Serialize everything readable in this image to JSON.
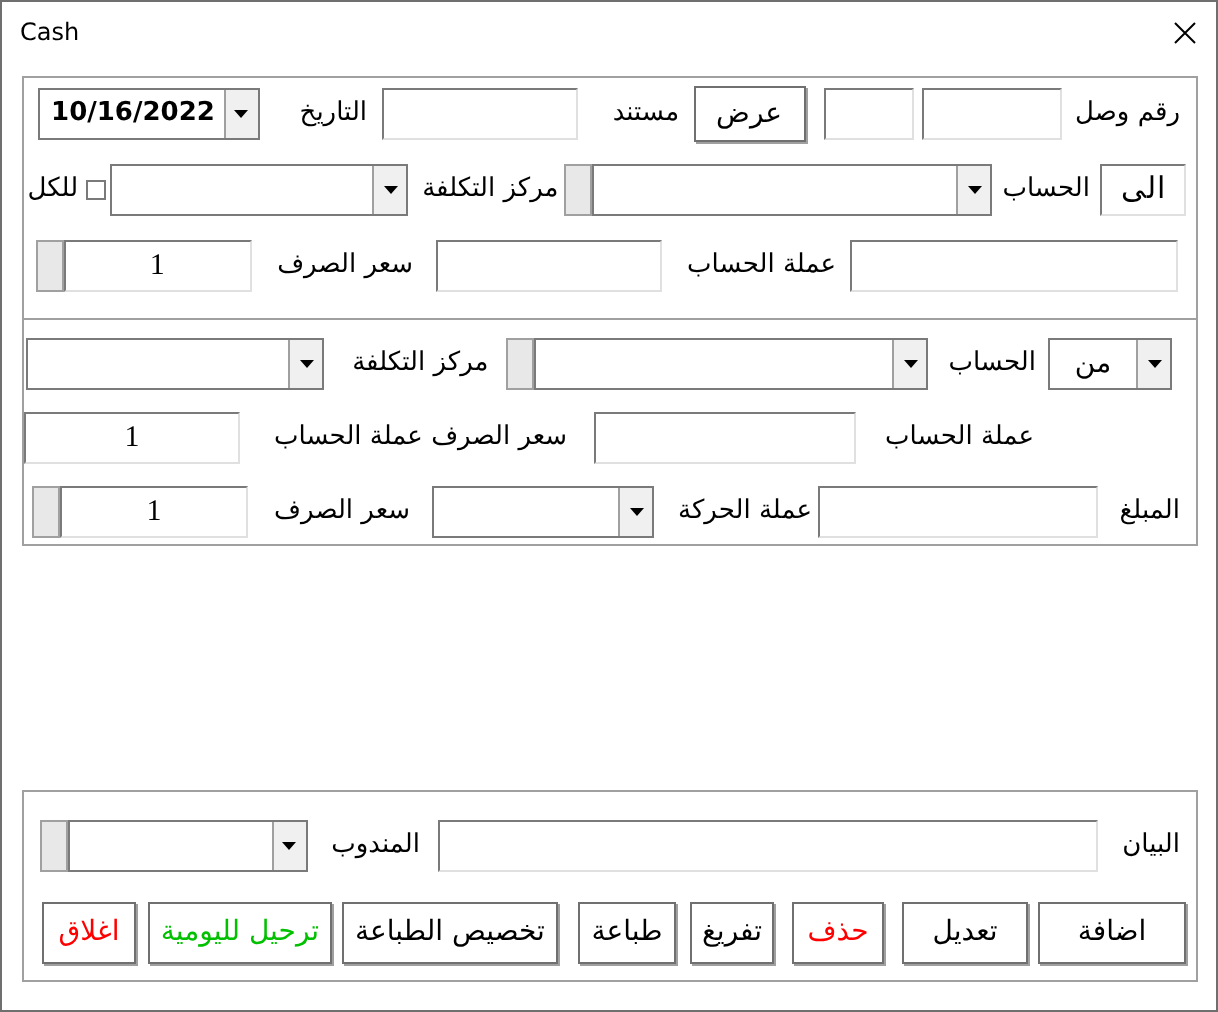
{
  "window": {
    "title": "Cash"
  },
  "receipt_panel": {
    "rows": [
      {
        "items": [
          {
            "kind": "label",
            "text": "رقم وصل"
          },
          {
            "kind": "field"
          },
          {
            "kind": "field"
          },
          {
            "kind": "button",
            "label": "عرض"
          },
          {
            "kind": "label",
            "text": "مستند"
          },
          {
            "kind": "field"
          },
          {
            "kind": "label",
            "text": "التاريخ"
          },
          {
            "kind": "date",
            "value": "10/16/2022"
          }
        ]
      },
      {
        "items": [
          {
            "kind": "field",
            "value": "الى"
          },
          {
            "kind": "label",
            "text": "الحساب"
          },
          {
            "kind": "combo",
            "spinner": true
          },
          {
            "kind": "label",
            "text": "مركز التكلفة"
          },
          {
            "kind": "combo"
          },
          {
            "kind": "checkbox",
            "label": "للكل",
            "checked": false
          }
        ]
      },
      {
        "items": [
          {
            "kind": "field"
          },
          {
            "kind": "label",
            "text": "عملة الحساب"
          },
          {
            "kind": "field"
          },
          {
            "kind": "label",
            "text": "سعر الصرف"
          },
          {
            "kind": "field",
            "value": "1",
            "spinner": true
          }
        ]
      }
    ]
  },
  "from_panel": {
    "rows": [
      {
        "items": [
          {
            "kind": "combo",
            "value": "من"
          },
          {
            "kind": "label",
            "text": "الحساب"
          },
          {
            "kind": "combo",
            "spinner": true
          },
          {
            "kind": "label",
            "text": "مركز التكلفة"
          },
          {
            "kind": "combo"
          }
        ]
      },
      {
        "items": [
          {
            "kind": "label",
            "text": "عملة الحساب"
          },
          {
            "kind": "field"
          },
          {
            "kind": "label",
            "text": "سعر الصرف عملة الحساب"
          },
          {
            "kind": "field",
            "value": "1"
          }
        ]
      },
      {
        "items": [
          {
            "kind": "label",
            "text": "المبلغ"
          },
          {
            "kind": "field"
          },
          {
            "kind": "label",
            "text": "عملة الحركة"
          },
          {
            "kind": "combo"
          },
          {
            "kind": "label",
            "text": "سعر الصرف"
          },
          {
            "kind": "field",
            "value": "1",
            "spinner": true
          }
        ]
      }
    ]
  },
  "notes_panel": {
    "rows": [
      {
        "items": [
          {
            "kind": "label",
            "text": "البيان"
          },
          {
            "kind": "field"
          },
          {
            "kind": "label",
            "text": "المندوب"
          },
          {
            "kind": "combo",
            "spinner": true
          }
        ]
      }
    ]
  },
  "buttons": [
    {
      "label": "اضافة",
      "color": "#000000"
    },
    {
      "label": "تعديل",
      "color": "#000000"
    },
    {
      "label": "حذف",
      "color": "#ff0000"
    },
    {
      "label": "تفريغ",
      "color": "#000000"
    },
    {
      "label": "طباعة",
      "color": "#000000"
    },
    {
      "label": "تخصيص الطباعة",
      "color": "#000000"
    },
    {
      "label": "ترحيل لليومية",
      "color": "#00c000"
    },
    {
      "label": "اغلاق",
      "color": "#ff0000"
    }
  ]
}
